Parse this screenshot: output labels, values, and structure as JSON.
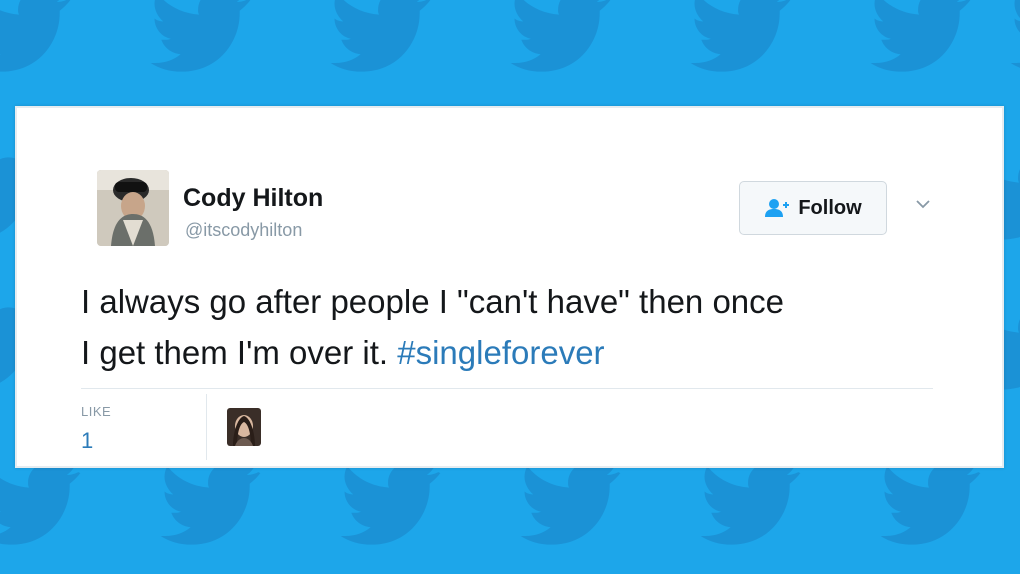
{
  "colors": {
    "background": "#1da6ea",
    "bird_pattern": "#1b92d6",
    "text": "#14171a",
    "secondary_text": "#8899a6",
    "link": "#2b7bb9",
    "card": "#ffffff"
  },
  "background": {
    "pattern_icon": "twitter-bird-icon"
  },
  "tweet": {
    "author": {
      "name": "Cody Hilton",
      "handle": "@itscodyhilton",
      "avatar_icon": "avatar-photo"
    },
    "follow_button": {
      "label": "Follow",
      "icon": "add-user-icon"
    },
    "menu_icon": "chevron-down-icon",
    "text_line1": "I always go after people I \"can't have\" then once",
    "text_line2_plain": "I get them I'm over it. ",
    "hashtag": "#singleforever",
    "stats": {
      "like_label": "LIKE",
      "like_count": "1"
    },
    "liker_avatar_icon": "liker-avatar-photo"
  }
}
